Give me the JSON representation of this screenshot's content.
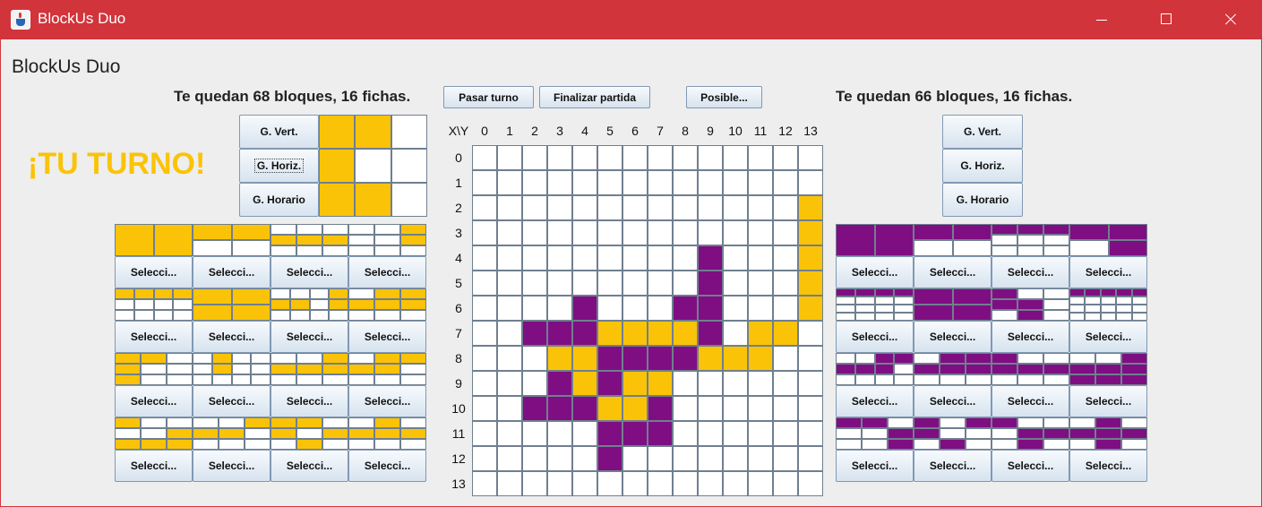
{
  "window": {
    "title": "BlockUs Duo"
  },
  "header": {
    "title": "BlockUs Duo"
  },
  "turn_label": "¡TU TURNO!",
  "players": {
    "left": {
      "remaining": "Te quedan 68 bloques, 16 fichas.",
      "color": "#fbc308"
    },
    "right": {
      "remaining": "Te quedan 66 bloques, 16 fichas.",
      "color": "#7f0e82"
    }
  },
  "controls": {
    "vert": "G. Vert.",
    "horiz": "G. Horiz.",
    "horario": "G. Horario"
  },
  "actions": {
    "pass": "Pasar turno",
    "finish": "Finalizar partida",
    "possible": "Posible..."
  },
  "select_label": "Selecci...",
  "board": {
    "corner_label": "X\\Y",
    "x_labels": [
      "0",
      "1",
      "2",
      "3",
      "4",
      "5",
      "6",
      "7",
      "8",
      "9",
      "10",
      "11",
      "12",
      "13"
    ],
    "y_labels": [
      "0",
      "1",
      "2",
      "3",
      "4",
      "5",
      "6",
      "7",
      "8",
      "9",
      "10",
      "11",
      "12",
      "13"
    ],
    "rows": [
      "..............",
      "..............",
      ".............Y",
      ".............Y",
      ".........P...Y",
      ".........P...Y",
      "....P...PP...Y",
      "..PPPYYYYP.YY.",
      "...YYPPPPYYY..",
      "...PYPYY......",
      "..PPPYYP......",
      ".....PPP......",
      ".....P........",
      ".............."
    ]
  },
  "preview": [
    "YY.",
    "Y..",
    "YY."
  ],
  "pieces": {
    "left": [
      {
        "cols": 2,
        "rows": 1,
        "cells": "YY"
      },
      {
        "cols": 2,
        "rows": 2,
        "cells": "YY.."
      },
      {
        "cols": 3,
        "rows": 3,
        "cells": "...YYY..."
      },
      {
        "cols": 3,
        "rows": 3,
        "cells": "..Y..Y..."
      },
      {
        "cols": 4,
        "rows": 3,
        "cells": "YYYY........"
      },
      {
        "cols": 2,
        "rows": 2,
        "cells": "YYYY"
      },
      {
        "cols": 4,
        "rows": 3,
        "cells": "...YYY.Y...."
      },
      {
        "cols": 3,
        "rows": 3,
        "cells": ".YYYYY..."
      },
      {
        "cols": 3,
        "rows": 3,
        "cells": "YY.Y..Y.."
      },
      {
        "cols": 4,
        "rows": 3,
        "cells": ".Y...Y......"
      },
      {
        "cols": 3,
        "rows": 3,
        "cells": "..YYYY..."
      },
      {
        "cols": 3,
        "rows": 3,
        "cells": ".YYYY...."
      },
      {
        "cols": 3,
        "rows": 3,
        "cells": "Y....YYYY"
      },
      {
        "cols": 3,
        "rows": 3,
        "cells": "..YYY...."
      },
      {
        "cols": 3,
        "rows": 3,
        "cells": "YY.Y.Y.Y."
      },
      {
        "cols": 3,
        "rows": 3,
        "cells": ".Y.YYY..."
      }
    ],
    "right": [
      {
        "cols": 2,
        "rows": 1,
        "cells": "PP"
      },
      {
        "cols": 2,
        "rows": 2,
        "cells": "PP.."
      },
      {
        "cols": 3,
        "rows": 3,
        "cells": "PPP......"
      },
      {
        "cols": 2,
        "rows": 2,
        "cells": "PP.P"
      },
      {
        "cols": 4,
        "rows": 4,
        "cells": "PPPP............"
      },
      {
        "cols": 2,
        "rows": 2,
        "cells": "PPPP"
      },
      {
        "cols": 3,
        "rows": 3,
        "cells": "P..PP..P."
      },
      {
        "cols": 5,
        "rows": 4,
        "cells": "PPPPP..............."
      },
      {
        "cols": 4,
        "rows": 3,
        "cells": "..PPPPP....."
      },
      {
        "cols": 3,
        "rows": 3,
        "cells": ".PPPPP..."
      },
      {
        "cols": 3,
        "rows": 3,
        "cells": "P..PPP..."
      },
      {
        "cols": 3,
        "rows": 3,
        "cells": "..PPPPPPP"
      },
      {
        "cols": 3,
        "rows": 3,
        "cells": "PP...P..P"
      },
      {
        "cols": 3,
        "rows": 3,
        "cells": "P.PP...P."
      },
      {
        "cols": 3,
        "rows": 3,
        "cells": "P...PP.P."
      },
      {
        "cols": 3,
        "rows": 3,
        "cells": ".P.PPP.P."
      }
    ]
  }
}
